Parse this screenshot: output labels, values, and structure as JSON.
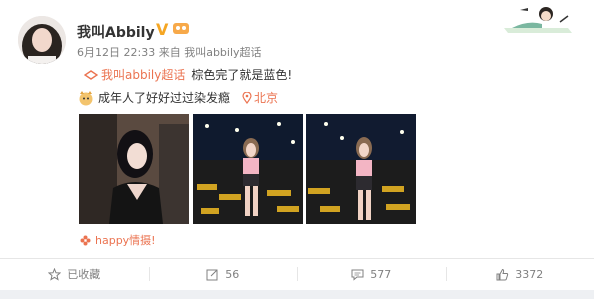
{
  "post": {
    "username": "我叫Abbily",
    "verified_badge": "V",
    "timestamp": "6月12日 22:33",
    "source_prefix": "来自",
    "source": "我叫abbily超话",
    "topic": "我叫abbily超话",
    "text1": "棕色完了就是蓝色!",
    "text2": "成年人了好好过过染发瘾",
    "location": "北京",
    "photo_tag": "happy情摄!"
  },
  "actions": {
    "collect": "已收藏",
    "repost": "56",
    "comment": "577",
    "like": "3372"
  },
  "colors": {
    "accent": "#eb7350",
    "verified": "#f5a623",
    "muted": "#808080"
  }
}
